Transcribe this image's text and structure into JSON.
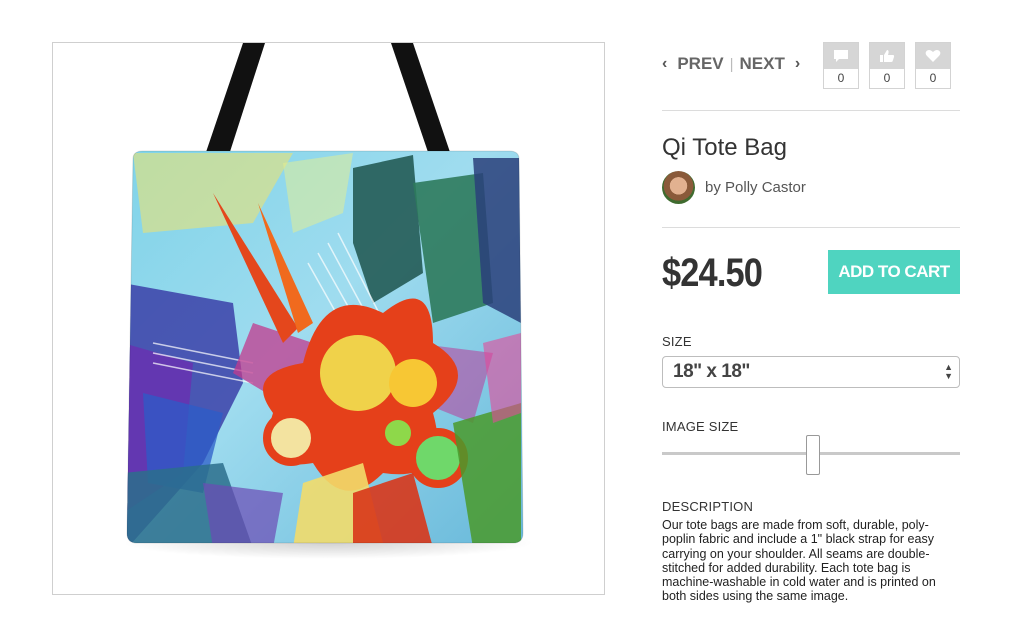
{
  "nav": {
    "prev_label": "PREV",
    "separator": "|",
    "next_label": "NEXT"
  },
  "social": [
    {
      "name": "comment-icon",
      "count": "0"
    },
    {
      "name": "like-icon",
      "count": "0"
    },
    {
      "name": "heart-icon",
      "count": "0"
    }
  ],
  "product": {
    "title": "Qi Tote Bag",
    "artist": "by Polly Castor",
    "price": "$24.50",
    "add_to_cart_label": "ADD TO CART"
  },
  "size": {
    "label": "SIZE",
    "selected": "18\" x 18\""
  },
  "image_size": {
    "label": "IMAGE SIZE",
    "level": 0.5
  },
  "description": {
    "label": "DESCRIPTION",
    "text": "Our tote bags are made from soft, durable, poly-poplin fabric and include a 1\" black strap for easy carrying on your shoulder.  All seams are double-stitched for added durability.  Each tote bag is machine-washable in cold water and is printed on both sides using the same image."
  },
  "colors": {
    "accent": "#4fd4c0",
    "strap": "#111111"
  }
}
